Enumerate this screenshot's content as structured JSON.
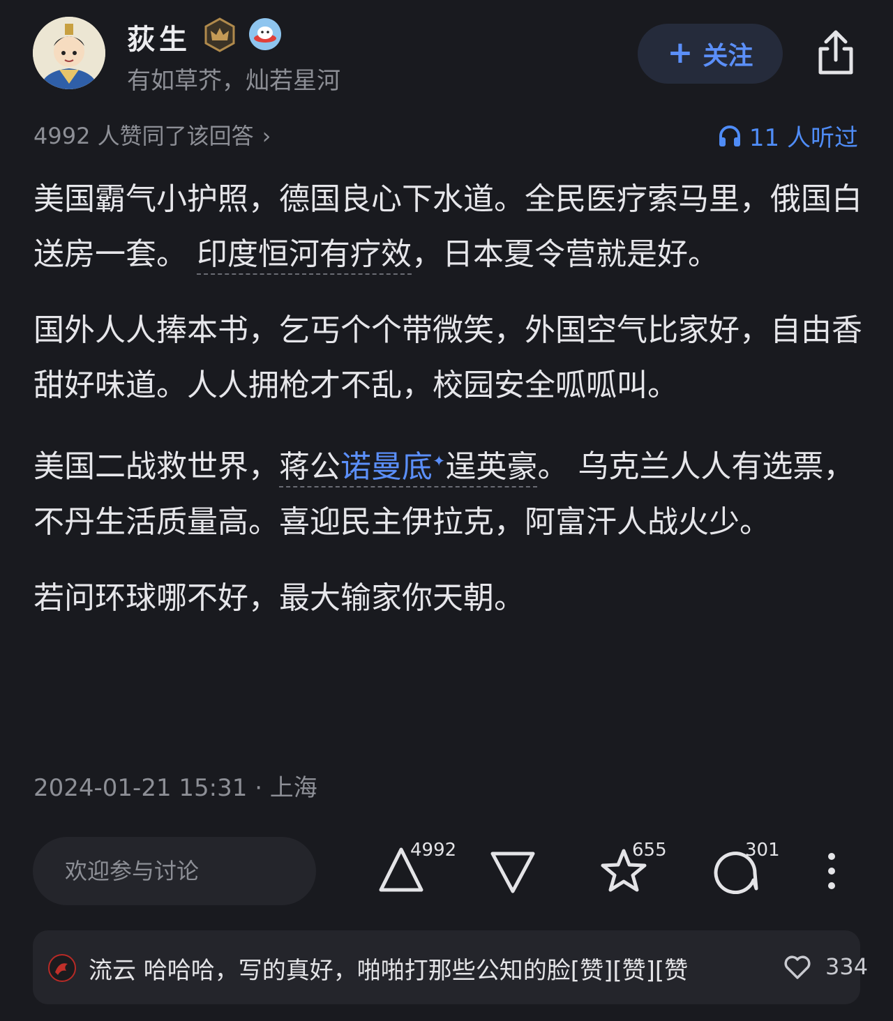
{
  "author": {
    "name": "荻生",
    "bio": "有如草芥，灿若星河"
  },
  "follow_button": {
    "label": "关注"
  },
  "upvote_summary": "4992 人赞同了该回答",
  "listen": {
    "label": "11 人听过"
  },
  "content": {
    "p1_a": "美国霸气小护照，德国良心下水道。全民医疗索马里，俄国白送房一套。",
    "p1_dotted": "印度恒河有疗效",
    "p1_b": "，日本夏令营就是好。",
    "p2": "国外人人捧本书，乞丐个个带微笑，外国空气比家好，自由香甜好味道。人人拥枪才不乱，校园安全呱呱叫。",
    "p3_a": "美国二战救世界，",
    "p3_dot_a": "蒋公",
    "p3_link": "诺曼底",
    "p3_sparkle": "✦",
    "p3_dot_b": "逞英豪",
    "p3_b": "。 乌克兰人人有选票，不丹生活质量高。喜迎民主伊拉克，阿富汗人战火少。",
    "p4": "若问环球哪不好，最大输家你天朝。"
  },
  "meta": "2024-01-21 15:31 · 上海",
  "comment_input": {
    "placeholder": "欢迎参与讨论"
  },
  "actions": {
    "upvote_count": "4992",
    "favorite_count": "655",
    "comment_count": "301"
  },
  "hot_comment": {
    "text": "流云 哈哈哈，写的真好，啪啪打那些公知的脸[赞][赞][赞",
    "likes": "334"
  },
  "colors": {
    "background": "#191a1f",
    "accent": "#5b8ff9",
    "muted": "#8d8f96"
  }
}
